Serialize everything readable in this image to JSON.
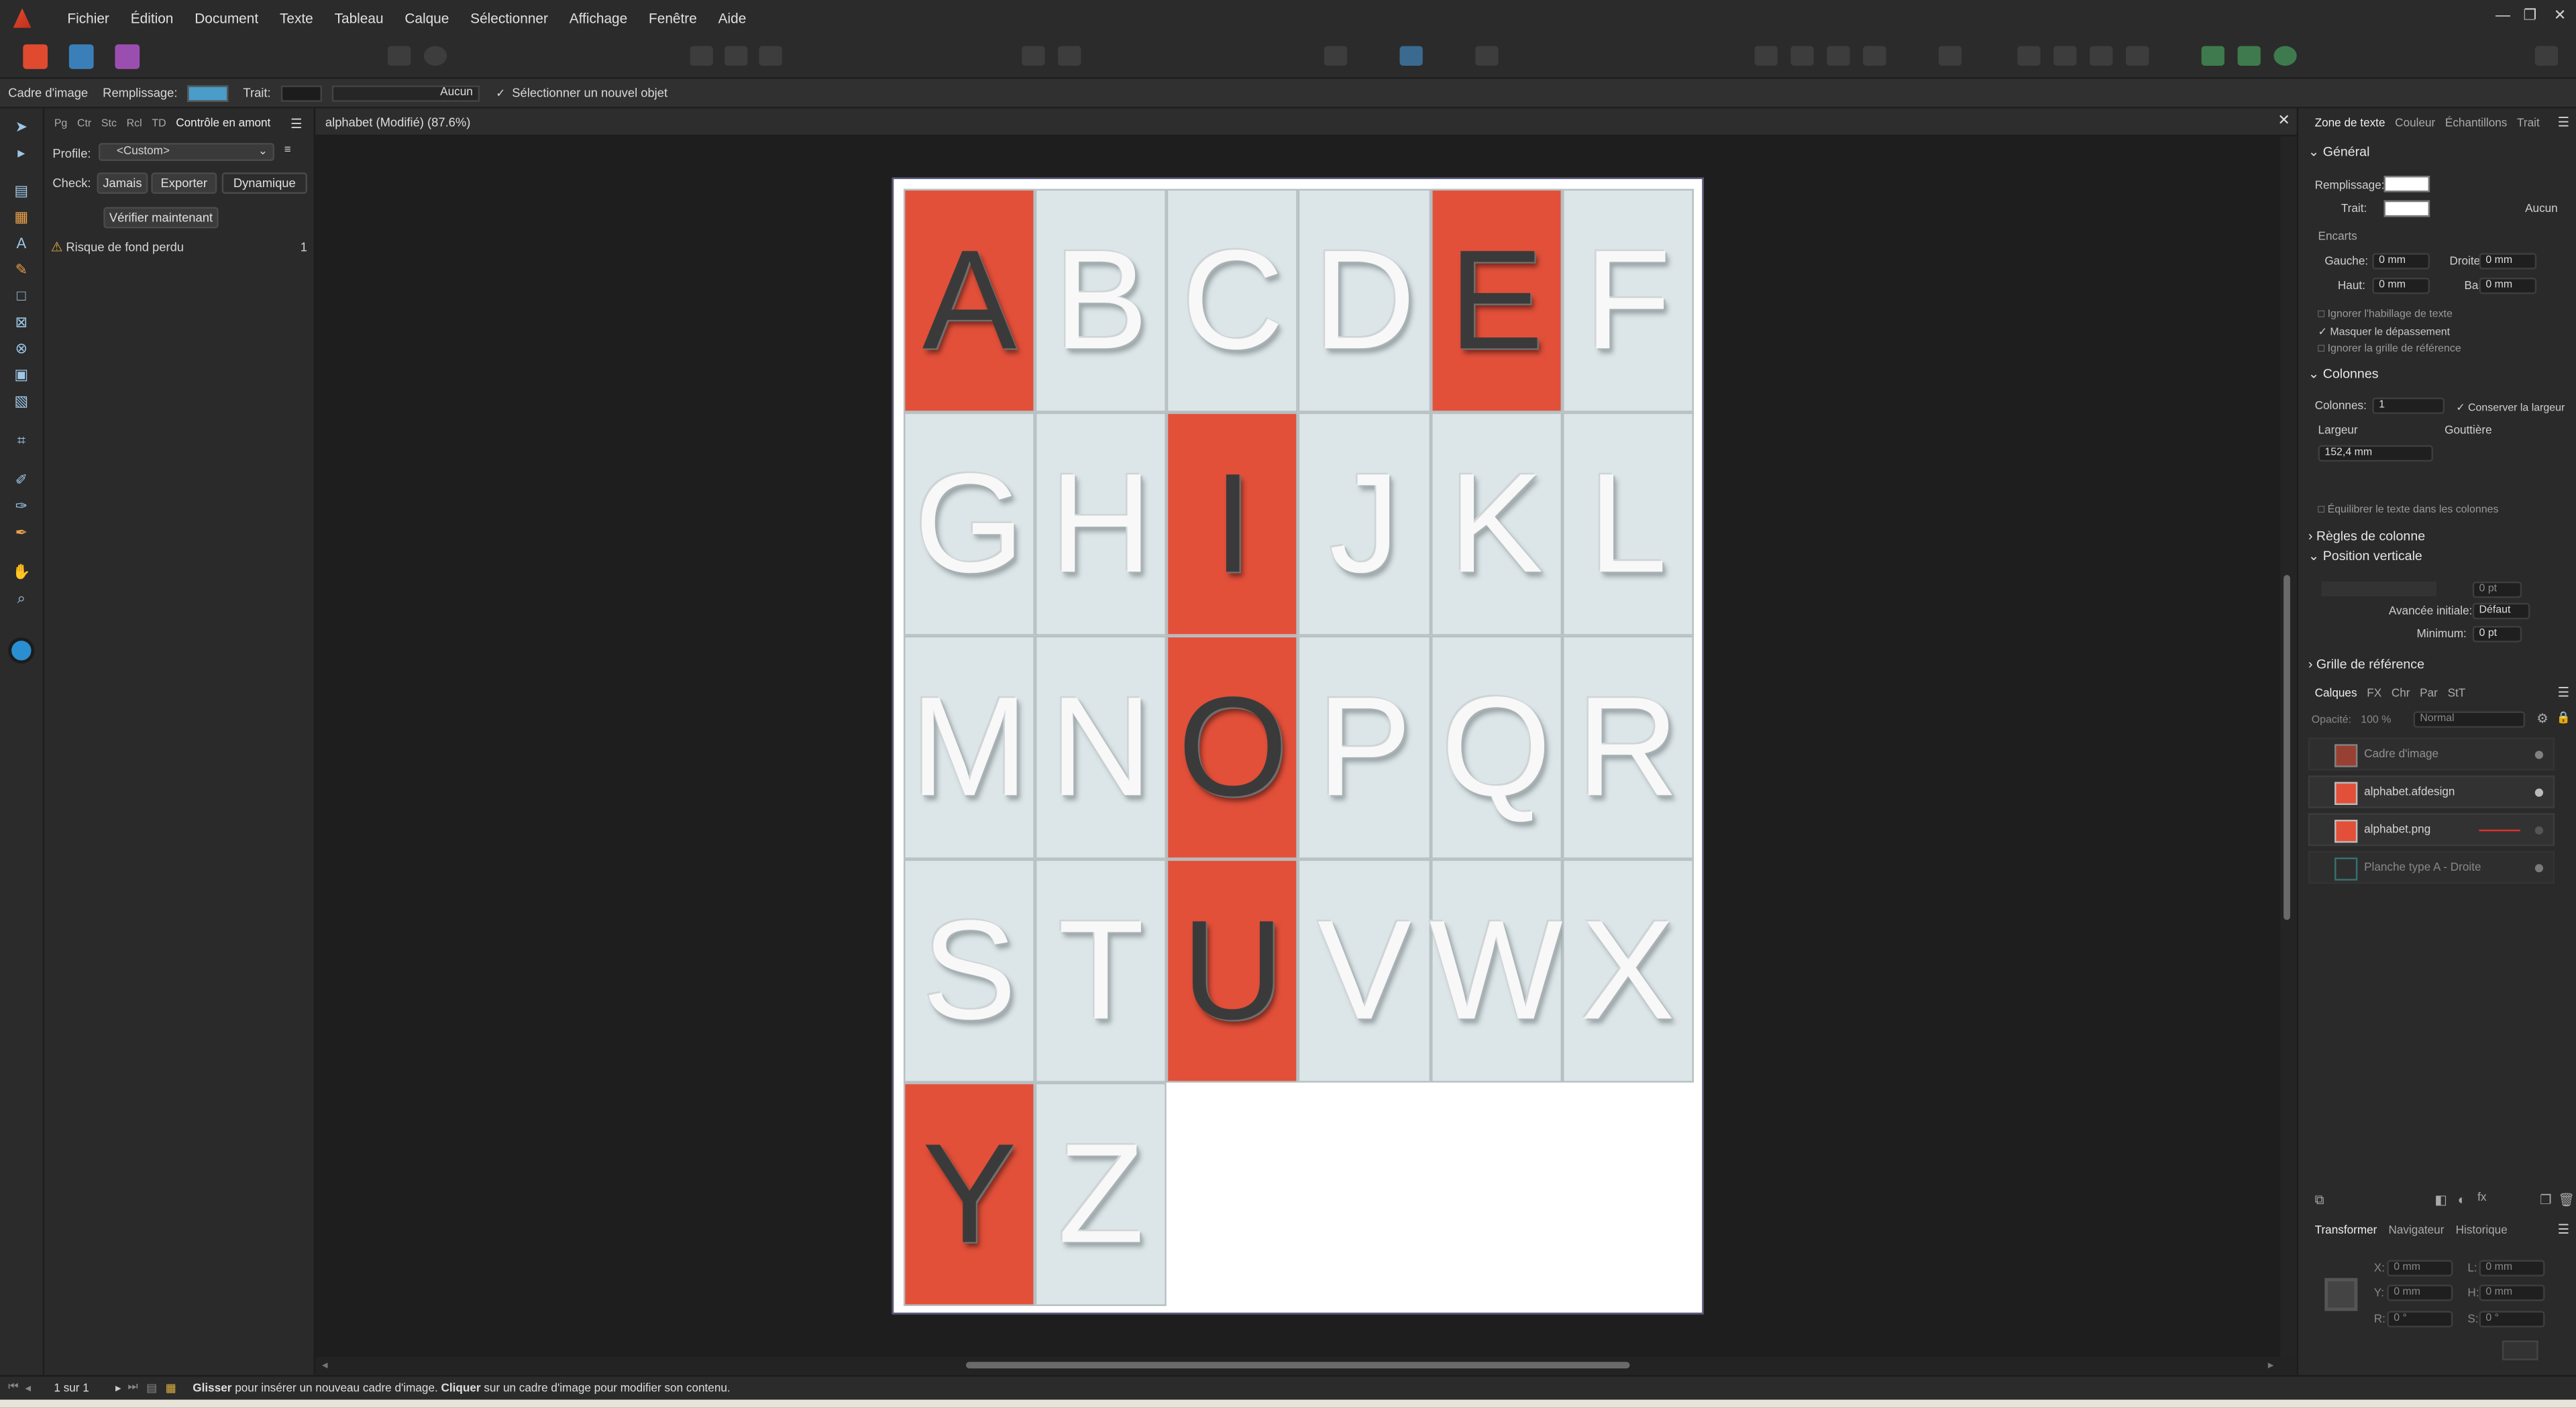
{
  "menubar": {
    "items": [
      "Fichier",
      "Édition",
      "Document",
      "Texte",
      "Tableau",
      "Calque",
      "Sélectionner",
      "Affichage",
      "Fenêtre",
      "Aide"
    ],
    "window_controls": [
      "—",
      "❐",
      "✕"
    ]
  },
  "context_bar": {
    "tool_name": "Cadre d'image",
    "fill_label": "Remplissage:",
    "fill_color": "#4a9cc9",
    "stroke_label": "Trait:",
    "stroke_value": "Aucun",
    "select_new_label": "Sélectionner un nouvel objet"
  },
  "preflight": {
    "tabs": [
      "Pg",
      "Ctr",
      "Stc",
      "Rcl",
      "TD",
      "Contrôle en amont"
    ],
    "profile_label": "Profile:",
    "profile_value": "<Custom>",
    "check_label": "Check:",
    "check_options": [
      "Jamais",
      "Exporter",
      "Dynamique"
    ],
    "verify_button": "Vérifier maintenant",
    "issue_label": "Risque de fond perdu",
    "issue_count": "1"
  },
  "document": {
    "tab_title": "alphabet (Modifié) (87.6%)",
    "letters": [
      "A",
      "B",
      "C",
      "D",
      "E",
      "F",
      "G",
      "H",
      "I",
      "J",
      "K",
      "L",
      "M",
      "N",
      "O",
      "P",
      "Q",
      "R",
      "S",
      "T",
      "U",
      "V",
      "W",
      "X",
      "Y",
      "Z"
    ],
    "red_letters": [
      "A",
      "E",
      "I",
      "O",
      "U",
      "Y"
    ],
    "red_color": "#e2503a",
    "light_color": "#dce5e7"
  },
  "right_panel": {
    "tabs": [
      "Zone de texte",
      "Couleur",
      "Échantillons",
      "Trait"
    ],
    "general_section": "Général",
    "fill_label": "Remplissage:",
    "stroke_label": "Trait:",
    "stroke_value": "Aucun",
    "insets_label": "Encarts",
    "left_label": "Gauche:",
    "left_value": "0 mm",
    "right_label": "Droite:",
    "right_value": "0 mm",
    "top_label": "Haut:",
    "top_value": "0 mm",
    "bottom_label": "Bas:",
    "bottom_value": "0 mm",
    "opt_ignore_wrap": "Ignorer l'habillage de texte",
    "opt_hide_overflow": "Masquer le dépassement",
    "opt_ignore_grid": "Ignorer la grille de référence",
    "columns_section": "Colonnes",
    "columns_label": "Colonnes:",
    "columns_value": "1",
    "keep_width_label": "Conserver la largeur",
    "width_label": "Largeur",
    "gutter_label": "Gouttière",
    "width_value": "152,4 mm",
    "balance_label": "Équilibrer le texte dans les colonnes",
    "column_rules_section": "Règles de colonne",
    "vertical_pos_section": "Position verticale",
    "vpos_value": "0 pt",
    "initial_advance_label": "Avancée initiale:",
    "initial_advance_value": "Défaut",
    "minimum_label": "Minimum:",
    "minimum_value": "0 pt",
    "baseline_grid_section": "Grille de référence"
  },
  "layers_panel": {
    "tabs": [
      "Calques",
      "FX",
      "Chr",
      "Par",
      "StT"
    ],
    "opacity_label": "Opacité:",
    "opacity_value": "100 %",
    "blend_mode": "Normal",
    "layers": [
      {
        "name": "Cadre d'image"
      },
      {
        "name": "alphabet.afdesign"
      },
      {
        "name": "alphabet.png"
      },
      {
        "name": "Planche type A - Droite"
      }
    ]
  },
  "transform_panel": {
    "tabs": [
      "Transformer",
      "Navigateur",
      "Historique"
    ],
    "x_label": "X:",
    "x_value": "0 mm",
    "l_label": "L:",
    "l_value": "0 mm",
    "y_label": "Y:",
    "y_value": "0 mm",
    "h_label": "H:",
    "h_value": "0 mm",
    "r_label": "R:",
    "r_value": "0 °",
    "s_label": "S:",
    "s_value": "0 °"
  },
  "status_bar": {
    "page_indicator": "1 sur 1",
    "hint_bold1": "Glisser",
    "hint_text1": " pour insérer un nouveau cadre d'image. ",
    "hint_bold2": "Cliquer",
    "hint_text2": " sur un cadre d'image pour modifier son contenu."
  }
}
